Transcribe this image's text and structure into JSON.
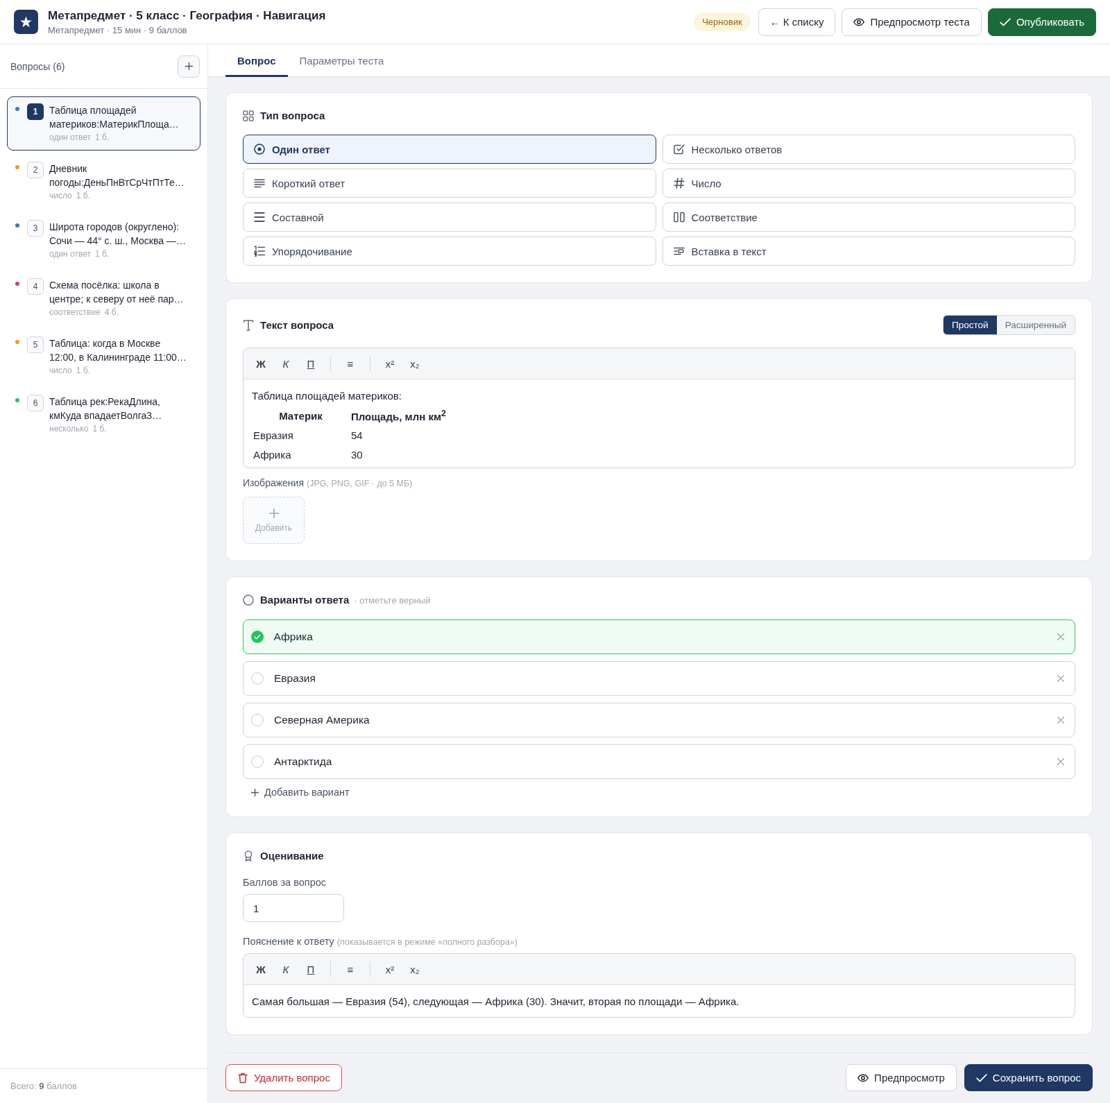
{
  "header": {
    "title": "Метапредмет · 5 класс · География · Навигация",
    "subtitle": "Метапредмет · 15 мин · 9 баллов",
    "status": "Черновик",
    "buttons": [
      {
        "label": "← К списку",
        "kind": "back"
      },
      {
        "label": "Предпросмотр теста",
        "kind": "preview"
      },
      {
        "label": "Опубликовать",
        "kind": "publish"
      }
    ]
  },
  "sidebar": {
    "title": "Вопросы (6)",
    "items": [
      {
        "number": "1",
        "title": "Таблица площадей материков:МатерикПлоща…",
        "type": "один ответ",
        "points": "1 б.",
        "color": "#2f7bd0",
        "selected": true
      },
      {
        "number": "2",
        "title": "Дневник погоды:ДеньПнВтСрЧтПтТе…",
        "type": "число",
        "points": "1 б.",
        "color": "#f59e0b",
        "selected": false
      },
      {
        "number": "3",
        "title": "Широта городов (округлено): Сочи — 44° с. ш., Москва —…",
        "type": "один ответ",
        "points": "1 б.",
        "color": "#2f7bd0",
        "selected": false
      },
      {
        "number": "4",
        "title": "Схема посёлка: школа в центре; к северу от неё пар…",
        "type": "соответствие",
        "points": "4 б.",
        "color": "#e6337a",
        "selected": false
      },
      {
        "number": "5",
        "title": "Таблица: когда в Москве 12:00, в Калининграде 11:00…",
        "type": "число",
        "points": "1 б.",
        "color": "#f59e0b",
        "selected": false
      },
      {
        "number": "6",
        "title": "Таблица рек:РекаДлина, кмКуда впадаетВолга3…",
        "type": "несколько",
        "points": "1 б.",
        "color": "#22c55e",
        "selected": false
      }
    ],
    "total": "Всего: **9** баллов"
  },
  "tabs": [
    {
      "label": "Вопрос",
      "selected": true
    },
    {
      "label": "Параметры теста",
      "selected": false
    }
  ],
  "question_type": {
    "title": "Тип вопроса",
    "options": [
      {
        "label": "Один ответ",
        "kind": "single",
        "selected": true
      },
      {
        "label": "Несколько ответов",
        "kind": "multiple",
        "selected": false
      },
      {
        "label": "Короткий ответ",
        "kind": "short",
        "selected": false
      },
      {
        "label": "Число",
        "kind": "number",
        "selected": false
      },
      {
        "label": "Составной",
        "kind": "compound",
        "selected": false
      },
      {
        "label": "Соответствие",
        "kind": "matching",
        "selected": false
      },
      {
        "label": "Упорядочивание",
        "kind": "ordering",
        "selected": false
      },
      {
        "label": "Вставка в текст",
        "kind": "cloze",
        "selected": false
      }
    ]
  },
  "question_text": {
    "title": "Текст вопроса",
    "modes": [
      {
        "label": "Простой",
        "selected": true
      },
      {
        "label": "Расширенный",
        "selected": false
      }
    ],
    "toolbar": [
      [
        {
          "label": "Ж",
          "kind": "bold"
        },
        {
          "label": "К",
          "kind": "italic"
        },
        {
          "label": "П",
          "kind": "underline"
        }
      ],
      [
        {
          "label": "≡",
          "kind": "list"
        }
      ],
      [
        {
          "label": "x²",
          "kind": "sup"
        },
        {
          "label": "x₂",
          "kind": "sub"
        }
      ]
    ],
    "intro": "Таблица площадей материков:",
    "table": {
      "columns": [
        "Материк",
        "Площадь, млн км$^{2}$"
      ],
      "rows": [
        [
          "Евразия",
          "54"
        ],
        [
          "Африка",
          "30"
        ]
      ]
    },
    "images_label": "Изображения",
    "images_hint": "(JPG, PNG, GIF · до 5 МБ)",
    "add_image": "Добавить"
  },
  "answers": {
    "title": "Варианты ответа",
    "hint": "· отметьте верный",
    "options": [
      {
        "text": "Африка",
        "correct": true
      },
      {
        "text": "Евразия",
        "correct": false
      },
      {
        "text": "Северная Америка",
        "correct": false
      },
      {
        "text": "Антарктида",
        "correct": false
      }
    ],
    "add_option": "Добавить вариант"
  },
  "grading": {
    "title": "Оценивание",
    "points_label": "Баллов за вопрос",
    "points_value": "1",
    "explanation_label": "Пояснение к ответу",
    "explanation_hint": "(показывается в режиме «полного разбора»)",
    "toolbar": [
      [
        {
          "label": "Ж",
          "kind": "bold"
        },
        {
          "label": "К",
          "kind": "italic"
        },
        {
          "label": "П",
          "kind": "underline"
        }
      ],
      [
        {
          "label": "≡",
          "kind": "list"
        }
      ],
      [
        {
          "label": "x²",
          "kind": "sup"
        },
        {
          "label": "x₂",
          "kind": "sub"
        }
      ]
    ],
    "explanation": "Самая большая — Евразия (54), следующая — Африка (30). Значит, вторая по площади — Африка."
  },
  "footer": {
    "delete": "Удалить вопрос",
    "preview": "Предпросмотр",
    "save": "Сохранить вопрос"
  }
}
